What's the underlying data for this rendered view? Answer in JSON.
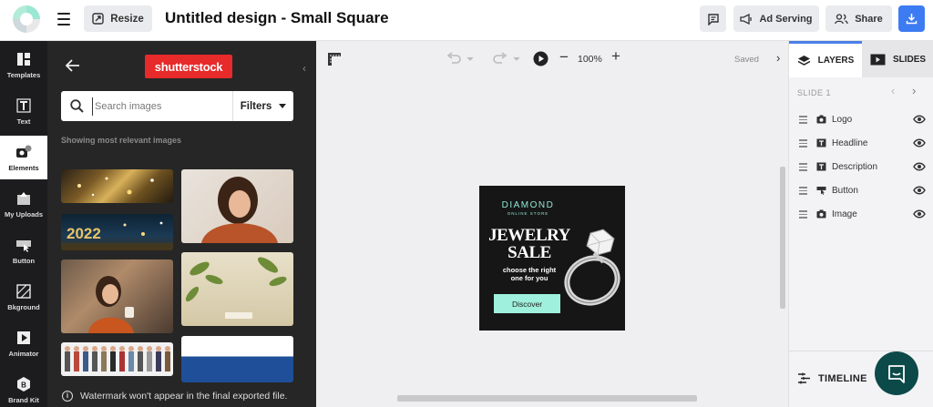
{
  "topbar": {
    "resize_label": "Resize",
    "doc_title": "Untitled design - Small Square",
    "ad_serving_label": "Ad Serving",
    "share_label": "Share"
  },
  "iconbar": {
    "items": [
      {
        "label": "Templates",
        "icon": "templates-icon"
      },
      {
        "label": "Text",
        "icon": "text-icon"
      },
      {
        "label": "Elements",
        "icon": "elements-icon",
        "active": true
      },
      {
        "label": "My Uploads",
        "icon": "upload-icon"
      },
      {
        "label": "Button",
        "icon": "button-icon"
      },
      {
        "label": "Bkground",
        "icon": "background-icon"
      },
      {
        "label": "Animator",
        "icon": "animator-icon"
      },
      {
        "label": "Brand Kit",
        "icon": "brand-kit-icon"
      }
    ]
  },
  "panel": {
    "provider": "shutterstock",
    "search_placeholder": "Search images",
    "filters_label": "Filters",
    "showing_text": "Showing most relevant images",
    "watermark_note": "Watermark won't appear in the final exported file."
  },
  "canvas": {
    "zoom": "100%",
    "saved_label": "Saved"
  },
  "ad": {
    "brand": "DIAMOND",
    "brand_sub": "ONLINE STORE",
    "headline_1": "JEWELRY",
    "headline_2": "SALE",
    "description_1": "choose the right",
    "description_2": "one for you",
    "button": "Discover"
  },
  "right_panel": {
    "layers_tab": "LAYERS",
    "slides_tab": "SLIDES",
    "slide_label": "SLIDE 1",
    "layers": [
      {
        "name": "Logo",
        "icon": "image-icon"
      },
      {
        "name": "Headline",
        "icon": "text-icon"
      },
      {
        "name": "Description",
        "icon": "text-icon"
      },
      {
        "name": "Button",
        "icon": "button-icon"
      },
      {
        "name": "Image",
        "icon": "image-icon"
      }
    ],
    "timeline_label": "TIMELINE"
  },
  "colors": {
    "accent": "#3d7bf2",
    "ad_accent": "#9ff0dc",
    "shutterstock_red": "#e72a2a",
    "chat_button": "#0c4a49"
  }
}
